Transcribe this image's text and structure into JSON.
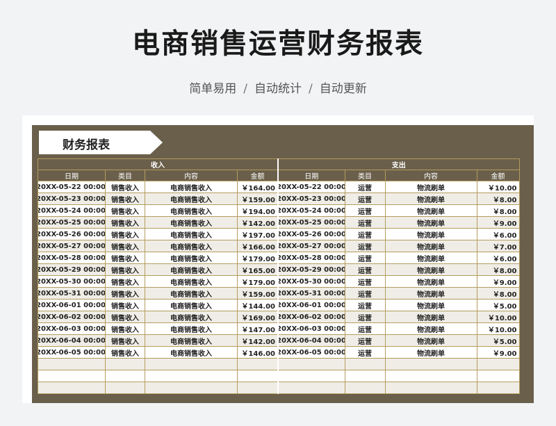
{
  "header": {
    "title": "电商销售运营财务报表",
    "subtitle_parts": [
      "简单易用",
      "自动统计",
      "自动更新"
    ],
    "separator": "/"
  },
  "sheet": {
    "banner": "财务报表",
    "income": {
      "group_label": "收入",
      "columns": [
        "日期",
        "类目",
        "内容",
        "金额"
      ],
      "rows": [
        [
          "20XX-05-22 00:00:00",
          "销售收入",
          "电商销售收入",
          "￥164.00"
        ],
        [
          "20XX-05-23 00:00:00",
          "销售收入",
          "电商销售收入",
          "￥159.00"
        ],
        [
          "20XX-05-24 00:00:00",
          "销售收入",
          "电商销售收入",
          "￥194.00"
        ],
        [
          "20XX-05-25 00:00:00",
          "销售收入",
          "电商销售收入",
          "￥142.00"
        ],
        [
          "20XX-05-26 00:00:00",
          "销售收入",
          "电商销售收入",
          "￥197.00"
        ],
        [
          "20XX-05-27 00:00:00",
          "销售收入",
          "电商销售收入",
          "￥166.00"
        ],
        [
          "20XX-05-28 00:00:00",
          "销售收入",
          "电商销售收入",
          "￥179.00"
        ],
        [
          "20XX-05-29 00:00:00",
          "销售收入",
          "电商销售收入",
          "￥165.00"
        ],
        [
          "20XX-05-30 00:00:00",
          "销售收入",
          "电商销售收入",
          "￥179.00"
        ],
        [
          "20XX-05-31 00:00:00",
          "销售收入",
          "电商销售收入",
          "￥159.00"
        ],
        [
          "20XX-06-01 00:00:00",
          "销售收入",
          "电商销售收入",
          "￥144.00"
        ],
        [
          "20XX-06-02 00:00:00",
          "销售收入",
          "电商销售收入",
          "￥169.00"
        ],
        [
          "20XX-06-03 00:00:00",
          "销售收入",
          "电商销售收入",
          "￥147.00"
        ],
        [
          "20XX-06-04 00:00:00",
          "销售收入",
          "电商销售收入",
          "￥142.00"
        ],
        [
          "20XX-06-05 00:00:00",
          "销售收入",
          "电商销售收入",
          "￥146.00"
        ],
        [
          "",
          "",
          "",
          ""
        ],
        [
          "",
          "",
          "",
          ""
        ],
        [
          "",
          "",
          "",
          ""
        ]
      ]
    },
    "expense": {
      "group_label": "支出",
      "columns": [
        "日期",
        "类目",
        "内容",
        "金额"
      ],
      "rows": [
        [
          "20XX-05-22 00:00:00",
          "运营",
          "物流刷单",
          "￥10.00"
        ],
        [
          "20XX-05-23 00:00:00",
          "运营",
          "物流刷单",
          "￥8.00"
        ],
        [
          "20XX-05-24 00:00:00",
          "运营",
          "物流刷单",
          "￥8.00"
        ],
        [
          "20XX-05-25 00:00:00",
          "运营",
          "物流刷单",
          "￥9.00"
        ],
        [
          "20XX-05-26 00:00:00",
          "运营",
          "物流刷单",
          "￥6.00"
        ],
        [
          "20XX-05-27 00:00:00",
          "运营",
          "物流刷单",
          "￥7.00"
        ],
        [
          "20XX-05-28 00:00:00",
          "运营",
          "物流刷单",
          "￥6.00"
        ],
        [
          "20XX-05-29 00:00:00",
          "运营",
          "物流刷单",
          "￥8.00"
        ],
        [
          "20XX-05-30 00:00:00",
          "运营",
          "物流刷单",
          "￥9.00"
        ],
        [
          "20XX-05-31 00:00:00",
          "运营",
          "物流刷单",
          "￥8.00"
        ],
        [
          "20XX-06-01 00:00:00",
          "运营",
          "物流刷单",
          "￥5.00"
        ],
        [
          "20XX-06-02 00:00:00",
          "运营",
          "物流刷单",
          "￥10.00"
        ],
        [
          "20XX-06-03 00:00:00",
          "运营",
          "物流刷单",
          "￥10.00"
        ],
        [
          "20XX-06-04 00:00:00",
          "运营",
          "物流刷单",
          "￥5.00"
        ],
        [
          "20XX-06-05 00:00:00",
          "运营",
          "物流刷单",
          "￥9.00"
        ],
        [
          "",
          "",
          "",
          ""
        ],
        [
          "",
          "",
          "",
          ""
        ],
        [
          "",
          "",
          "",
          ""
        ]
      ]
    }
  }
}
